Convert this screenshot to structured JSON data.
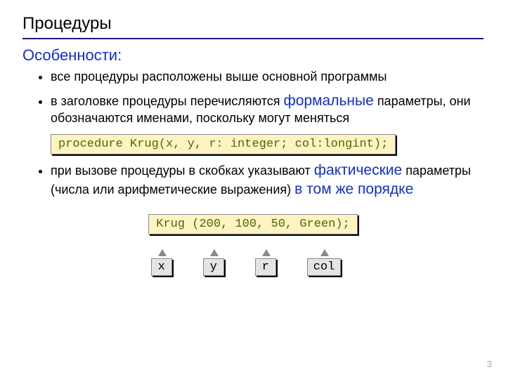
{
  "title": "Процедуры",
  "subhead": "Особенности:",
  "bullets": {
    "b1": "все процедуры расположены выше основной программы",
    "b2_a": "в заголовке процедуры перечисляются ",
    "b2_term": "формальные",
    "b2_b": " параметры, они обозначаются именами, поскольку могут меняться",
    "b3_a": "при вызове процедуры в скобках указывают ",
    "b3_term": "фактические",
    "b3_b": " параметры (числа или арифметические выражения) ",
    "b3_tail": "в том же порядке"
  },
  "code1": "procedure Krug(x, y, r: integer; col:longint);",
  "code2": "Krug (200, 100, 50, Green);",
  "labels": {
    "x": "x",
    "y": "y",
    "r": "r",
    "col": "col"
  },
  "page": "3"
}
